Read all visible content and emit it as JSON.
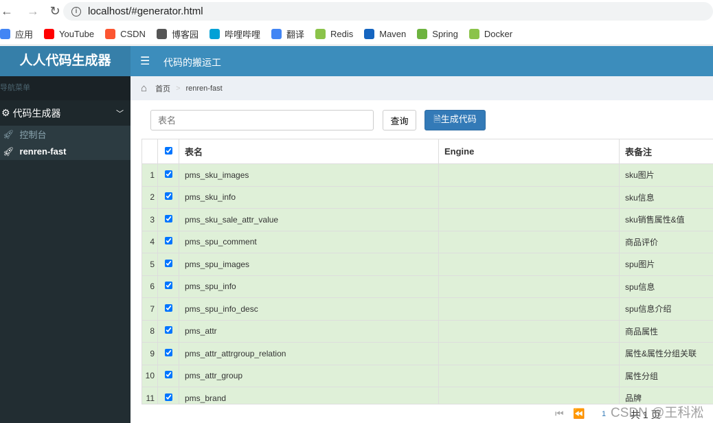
{
  "browser": {
    "url": "localhost/#generator.html"
  },
  "bookmarks": [
    {
      "label": "应用",
      "icon": "apps-grid-icon",
      "color": "#4285f4"
    },
    {
      "label": "YouTube",
      "icon": "youtube-icon",
      "color": "#ff0000"
    },
    {
      "label": "CSDN",
      "icon": "csdn-icon",
      "color": "#fc5531"
    },
    {
      "label": "博客园",
      "icon": "cnblogs-icon",
      "color": "#555555"
    },
    {
      "label": "哔哩哔哩",
      "icon": "bilibili-icon",
      "color": "#00a1d6"
    },
    {
      "label": "翻译",
      "icon": "google-translate-icon",
      "color": "#4285f4"
    },
    {
      "label": "Redis",
      "icon": "site-icon",
      "color": "#8bc34a"
    },
    {
      "label": "Maven",
      "icon": "maven-icon",
      "color": "#1565c0"
    },
    {
      "label": "Spring",
      "icon": "spring-icon",
      "color": "#6db33f"
    },
    {
      "label": "Docker",
      "icon": "site-icon",
      "color": "#8bc34a"
    }
  ],
  "header": {
    "logo": "人人代码生成器",
    "title": "代码的搬运工"
  },
  "sidebar": {
    "nav_header": "导航菜单",
    "menu": "代码生成器",
    "items": [
      {
        "label": "控制台"
      },
      {
        "label": "renren-fast"
      }
    ]
  },
  "breadcrumb": {
    "home": "首页",
    "current": "renren-fast"
  },
  "toolbar": {
    "search_placeholder": "表名",
    "query_label": "查询",
    "generate_label": "生成代码"
  },
  "table": {
    "headers": [
      "表名",
      "Engine",
      "表备注"
    ],
    "rows": [
      {
        "n": "1",
        "name": "pms_sku_images",
        "engine": "",
        "comment": "sku图片"
      },
      {
        "n": "2",
        "name": "pms_sku_info",
        "engine": "",
        "comment": "sku信息"
      },
      {
        "n": "3",
        "name": "pms_sku_sale_attr_value",
        "engine": "",
        "comment": "sku销售属性&值"
      },
      {
        "n": "4",
        "name": "pms_spu_comment",
        "engine": "",
        "comment": "商品评价"
      },
      {
        "n": "5",
        "name": "pms_spu_images",
        "engine": "",
        "comment": "spu图片"
      },
      {
        "n": "6",
        "name": "pms_spu_info",
        "engine": "",
        "comment": "spu信息"
      },
      {
        "n": "7",
        "name": "pms_spu_info_desc",
        "engine": "",
        "comment": "spu信息介绍"
      },
      {
        "n": "8",
        "name": "pms_attr",
        "engine": "",
        "comment": "商品属性"
      },
      {
        "n": "9",
        "name": "pms_attr_attrgroup_relation",
        "engine": "",
        "comment": "属性&属性分组关联"
      },
      {
        "n": "10",
        "name": "pms_attr_group",
        "engine": "",
        "comment": "属性分组"
      },
      {
        "n": "11",
        "name": "pms_brand",
        "engine": "",
        "comment": "品牌"
      }
    ]
  },
  "pager": {
    "page": "1",
    "total_text": "共 1 页"
  },
  "watermark": "CSDN @王科淞"
}
